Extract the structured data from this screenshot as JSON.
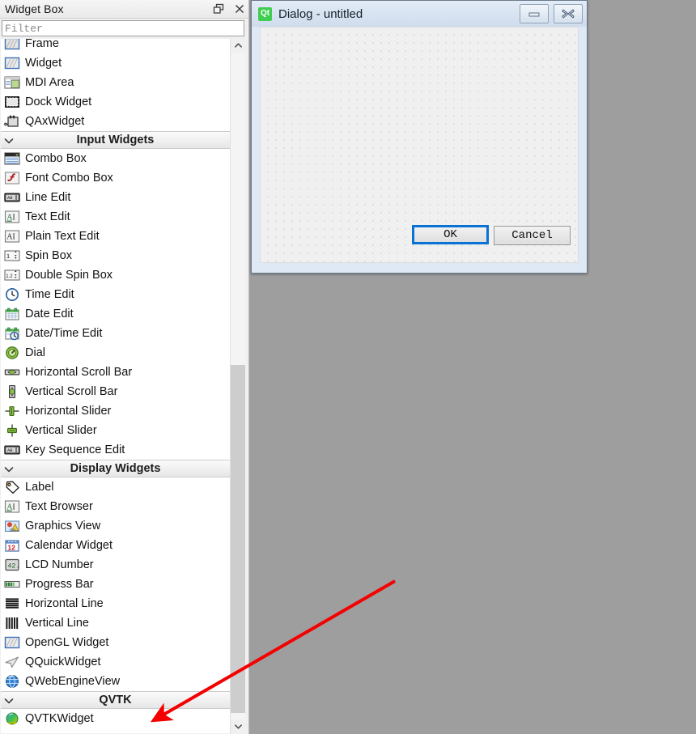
{
  "widget_box": {
    "title": "Widget Box",
    "titlebar_icons": [
      "float-icon",
      "close-icon"
    ],
    "filter": {
      "value": "",
      "placeholder": "Filter"
    },
    "scrollbar": {
      "up_icon": "chevron-up-icon",
      "down_icon": "chevron-down-icon"
    },
    "entries": [
      {
        "kind": "item",
        "label": "Frame",
        "icon": "frame-icon"
      },
      {
        "kind": "item",
        "label": "Widget",
        "icon": "widget-icon"
      },
      {
        "kind": "item",
        "label": "MDI Area",
        "icon": "mdi-area-icon"
      },
      {
        "kind": "item",
        "label": "Dock Widget",
        "icon": "dock-widget-icon"
      },
      {
        "kind": "item",
        "label": "QAxWidget",
        "icon": "qaxwidget-icon"
      },
      {
        "kind": "section",
        "label": "Input Widgets",
        "icon": "chevron-down-icon"
      },
      {
        "kind": "item",
        "label": "Combo Box",
        "icon": "combo-box-icon"
      },
      {
        "kind": "item",
        "label": "Font Combo Box",
        "icon": "font-combo-box-icon"
      },
      {
        "kind": "item",
        "label": "Line Edit",
        "icon": "line-edit-icon"
      },
      {
        "kind": "item",
        "label": "Text Edit",
        "icon": "text-edit-icon"
      },
      {
        "kind": "item",
        "label": "Plain Text Edit",
        "icon": "plain-text-edit-icon"
      },
      {
        "kind": "item",
        "label": "Spin Box",
        "icon": "spin-box-icon"
      },
      {
        "kind": "item",
        "label": "Double Spin Box",
        "icon": "double-spin-box-icon"
      },
      {
        "kind": "item",
        "label": "Time Edit",
        "icon": "time-edit-icon"
      },
      {
        "kind": "item",
        "label": "Date Edit",
        "icon": "date-edit-icon"
      },
      {
        "kind": "item",
        "label": "Date/Time Edit",
        "icon": "date-time-edit-icon"
      },
      {
        "kind": "item",
        "label": "Dial",
        "icon": "dial-icon"
      },
      {
        "kind": "item",
        "label": "Horizontal Scroll Bar",
        "icon": "horizontal-scroll-bar-icon"
      },
      {
        "kind": "item",
        "label": "Vertical Scroll Bar",
        "icon": "vertical-scroll-bar-icon"
      },
      {
        "kind": "item",
        "label": "Horizontal Slider",
        "icon": "horizontal-slider-icon"
      },
      {
        "kind": "item",
        "label": "Vertical Slider",
        "icon": "vertical-slider-icon"
      },
      {
        "kind": "item",
        "label": "Key Sequence Edit",
        "icon": "key-sequence-edit-icon"
      },
      {
        "kind": "section",
        "label": "Display Widgets",
        "icon": "chevron-down-icon"
      },
      {
        "kind": "item",
        "label": "Label",
        "icon": "label-icon"
      },
      {
        "kind": "item",
        "label": "Text Browser",
        "icon": "text-browser-icon"
      },
      {
        "kind": "item",
        "label": "Graphics View",
        "icon": "graphics-view-icon"
      },
      {
        "kind": "item",
        "label": "Calendar Widget",
        "icon": "calendar-widget-icon"
      },
      {
        "kind": "item",
        "label": "LCD Number",
        "icon": "lcd-number-icon"
      },
      {
        "kind": "item",
        "label": "Progress Bar",
        "icon": "progress-bar-icon"
      },
      {
        "kind": "item",
        "label": "Horizontal Line",
        "icon": "horizontal-line-icon"
      },
      {
        "kind": "item",
        "label": "Vertical Line",
        "icon": "vertical-line-icon"
      },
      {
        "kind": "item",
        "label": "OpenGL Widget",
        "icon": "opengl-widget-icon"
      },
      {
        "kind": "item",
        "label": "QQuickWidget",
        "icon": "qquickwidget-icon"
      },
      {
        "kind": "item",
        "label": "QWebEngineView",
        "icon": "qwebengineview-icon"
      },
      {
        "kind": "section",
        "label": "QVTK",
        "icon": "chevron-down-icon"
      },
      {
        "kind": "item",
        "label": "QVTKWidget",
        "icon": "qvtkwidget-icon"
      }
    ]
  },
  "dialog": {
    "title": "Dialog - untitled",
    "logo_text": "Qt",
    "minimize_icon": "minimize-icon",
    "close_icon": "close-icon",
    "buttons": [
      {
        "label": "OK",
        "name": "ok-button",
        "focused": true
      },
      {
        "label": "Cancel",
        "name": "cancel-button",
        "focused": false
      }
    ]
  },
  "annotation": {
    "arrow_color": "#f40000",
    "points_at": "QVTKWidget"
  },
  "colors": {
    "desktop": "#9e9e9e",
    "panel": "#f0f0f0",
    "list_bg": "#ffffff",
    "qt_green": "#41cd52",
    "focus_blue": "#0a72d4",
    "annotation_red": "#f40000"
  }
}
